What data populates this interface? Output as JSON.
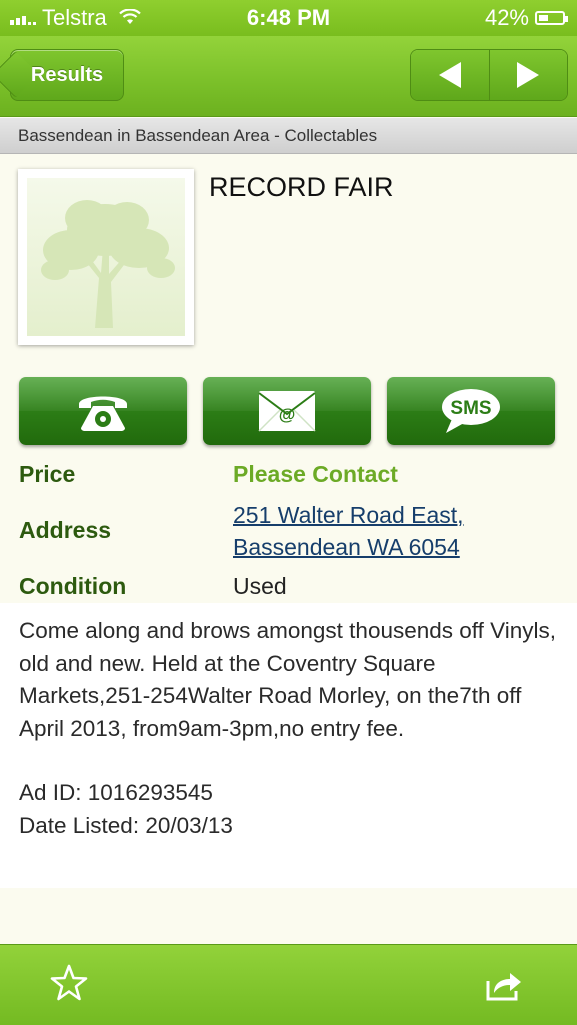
{
  "status_bar": {
    "carrier": "Telstra",
    "time": "6:48 PM",
    "battery": "42%",
    "battery_level": 0.42
  },
  "nav": {
    "back_label": "Results",
    "prev_icon": "left-arrow-icon",
    "next_icon": "right-arrow-icon"
  },
  "category": "Bassendean in Bassendean Area - Collectables",
  "listing": {
    "title": "RECORD FAIR",
    "thumbnail_icon": "tree-placeholder-icon"
  },
  "actions": {
    "call_icon": "phone-icon",
    "email_icon": "envelope-icon",
    "sms_label": "SMS"
  },
  "details": {
    "price_label": "Price",
    "price_value": "Please Contact",
    "address_label": "Address",
    "address_line1": "251 Walter Road East,",
    "address_line2": "Bassendean WA 6054",
    "condition_label": "Condition",
    "condition_value": "Used"
  },
  "description": {
    "text": "Come along and brows amongst thousends off Vinyls, old and new. Held at the Coventry Square Markets,251-254Walter Road Morley, on the7th off April 2013, from9am-3pm,no entry fee.",
    "ad_id": "Ad ID:  1016293545",
    "date_listed": "Date Listed: 20/03/13"
  },
  "toolbar": {
    "favorite_icon": "star-icon",
    "share_icon": "share-icon"
  },
  "colors": {
    "bar_green": "#7cc12a",
    "button_green": "#2c7d16",
    "label_green": "#2d5a0f",
    "price_green": "#6caa26",
    "link_blue": "#163e6b",
    "page_bg": "#fbfbef"
  }
}
